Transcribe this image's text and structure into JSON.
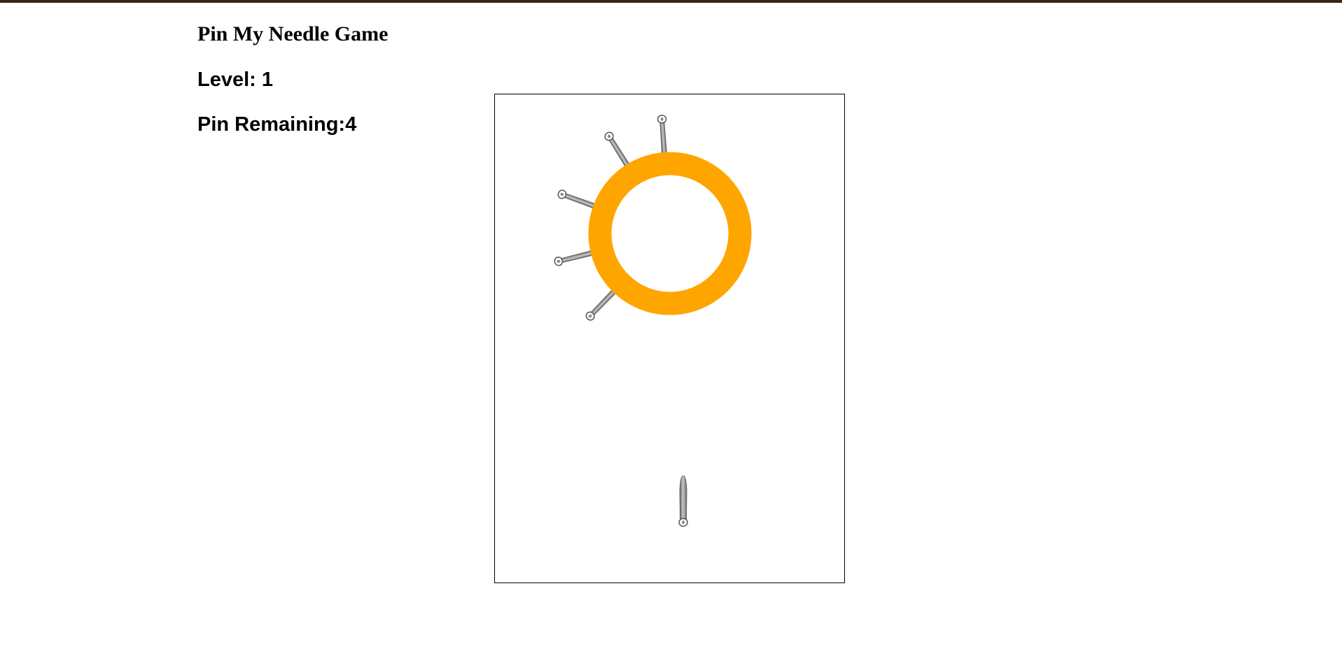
{
  "title": "Pin My Needle Game",
  "level": {
    "label": "Level: ",
    "value": "1"
  },
  "pins": {
    "label": "Pin Remaining:",
    "value": "4"
  },
  "colors": {
    "ring": "#FFA500",
    "needle": "#808080",
    "board_border": "#000000",
    "top_bar": "#3a2416"
  },
  "game": {
    "pinned_needle_angles_deg": [
      -4,
      -32,
      -70,
      -104,
      -136
    ],
    "pins_remaining": 4,
    "queued_needle_icon": "needle-icon"
  }
}
